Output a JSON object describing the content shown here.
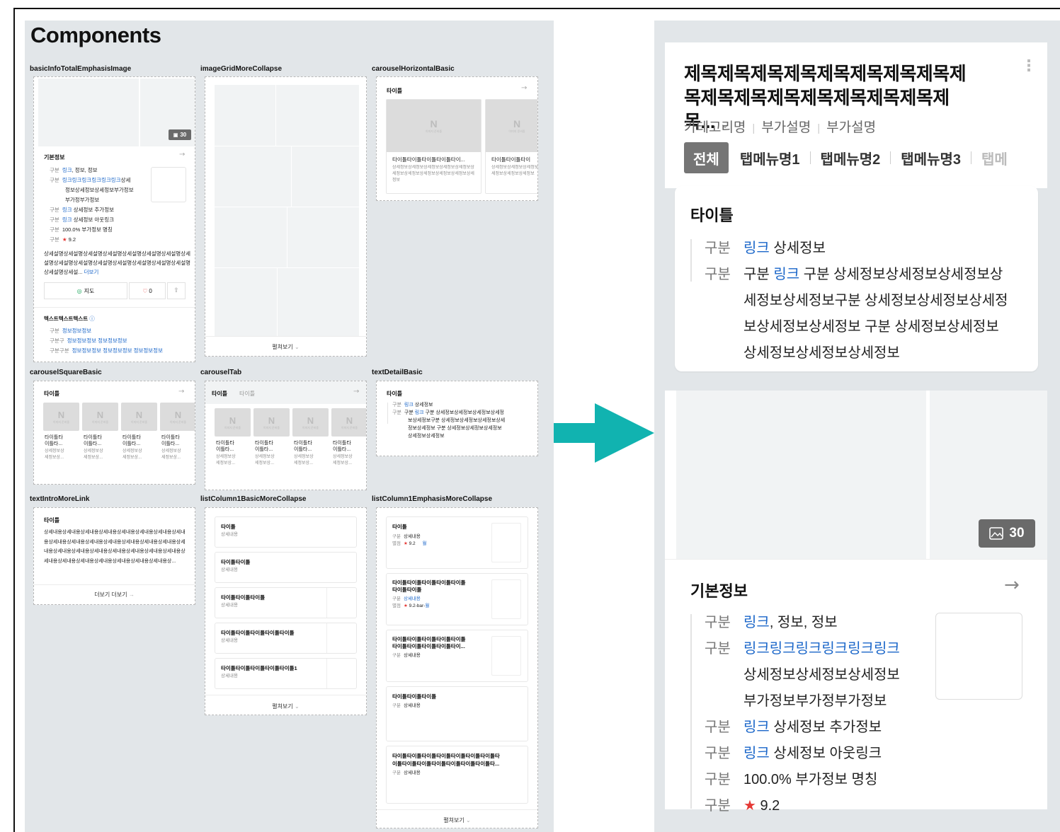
{
  "canvas": {
    "title": "Components"
  },
  "labels": {
    "l1": "basicInfoTotalEmphasisImage",
    "l2": "imageGridMoreCollapse",
    "l3": "carouselHorizontalBasic",
    "l4": "carouselSquareBasic",
    "l5": "carouselTab",
    "l6": "textDetailBasic",
    "l7": "textIntroMoreLink",
    "l8": "listColumn1BasicMoreCollapse",
    "l9": "listColumn1EmphasisMoreCollapse"
  },
  "basicInfo": {
    "badge": "30",
    "title": "기본정보",
    "k": "구분",
    "r1_link": "링크",
    "r1_rest": ", 정보, 정보",
    "r2_link": "링크링크링크링크링크링크",
    "r2_rest": "상세",
    "r2_cont1": "정보상세정보상세정보부가정보",
    "r2_cont2": "부가정부가정보",
    "r3_link": "링크",
    "r3_rest": " 상세정보 추가정보",
    "r4_link": "링크",
    "r4_rest": " 상세정보 아웃링크",
    "r5_rest": "100.0% 부가정보 명칭",
    "r6_star": "★",
    "r6_rest": " 9.2",
    "desc": "상세설명상세설명상세설명상세설명상세설명상세설명상세설명상세설명상세설명상세설명상세설명상세설명상세설명상세설명상세설명상세설명상세설... ",
    "desc_more": "더보기",
    "btn_map": "지도",
    "btn_like": "0",
    "section2": "텍스트텍스트텍스트",
    "s2_k1": "구분",
    "s2_v1": "정보정보정보",
    "s2_k2": "구분구",
    "s2_v2": "정보정보정보 정보정보정보",
    "s2_k3": "구분구분",
    "s2_v3": "정보정보정보 정보정보정보 정보정보정보"
  },
  "imageGrid": {
    "more": "펼쳐보기"
  },
  "carouselH": {
    "title": "타이틀",
    "nbox_caption": "이미지 준비중",
    "c1_title": "타이틀타이틀타이틀타이틀타이...",
    "c1_desc": "상세정보상세정보상세정보상세정보상세정보상세정보상세정보상세정보상세정보상세정보상세정보",
    "c2_title": "타이틀타이틀타이",
    "c2_desc": "상세정보상세정보상세정보상세정보상세정보상세정보"
  },
  "carouselSquare": {
    "title": "타이틀",
    "item_title1": "타이틀타",
    "item_title2": "이틀타...",
    "item_desc1": "상세정보상",
    "item_desc2": "세정보상..."
  },
  "carouselTab": {
    "tab1": "타이틀",
    "tab2": "타이틀"
  },
  "textDetail": {
    "title": "타이틀",
    "k": "구분",
    "r1_link": "링크",
    "r1_rest": " 상세정보",
    "r2_a": "구분 ",
    "r2_link": "링크",
    "r2_b": " 구분 상세정보상세정보상세정보상세정",
    "r2_c2": "보상세정보구분 상세정보상세정보상세정보상세",
    "r2_c3": "정보상세정보 구분 상세정보상세정보상세정보",
    "r2_c4": "상세정보상세정보"
  },
  "textIntro": {
    "title": "타이틀",
    "body": "상세내용상세내용상세내용상세내용상세내용상세내용상세내용상세내용상세내용상세내용상세내용상세내용상세내용상세내용상세내용상세내용상세내용상세내용상세내용상세내용상세내용상세내용상세내용상세내용상세내용상세내용상세내용상세내용상세내용상세내용상...",
    "more": "더보기 더보기"
  },
  "listBasic": {
    "items": [
      {
        "title": "타이틀",
        "desc": "상세내용"
      },
      {
        "title": "타이틀타이틀",
        "desc": "상세내용"
      },
      {
        "title": "타이틀타이틀타이틀",
        "desc": "상세내용"
      },
      {
        "title": "타이틀타이틀타이틀타이틀타이틀",
        "desc": "상세내용"
      },
      {
        "title": "타이틀타이틀타이틀타이틀타이틀1",
        "desc": "상세내용"
      }
    ],
    "more": "펼쳐보기"
  },
  "listEmph": {
    "i1_title": "타이틀",
    "i1_k": "구분",
    "i1_v": "상세내용",
    "i1_k2": "별점",
    "i1_star": "★",
    "i1_score": " 9.2",
    "i1_link": "월",
    "i2_title": "타이틀타이틀타이틀타이틀타이틀",
    "i2_title2": "타이틀타이틀",
    "i2_k": "구분",
    "i2_v": "상세내용",
    "i2_k2": "별점",
    "i2_star": "★",
    "i2_score": " 9.2-bar-",
    "i2_link": "월",
    "i3_title": "타이틀타이틀타이틀타이틀타이틀",
    "i3_title2": "타이틀타이틀타이틀타이틀타이...",
    "i3_k": "구분",
    "i3_v": "상세내용",
    "i4_title": "타이틀타이틀타이틀",
    "i4_k": "구분",
    "i4_v": "상세내용",
    "i5_title": "타이틀타이틀타이틀타이틀타이틀타이틀타이틀타",
    "i5_title2": "이틀타이틀타이틀타이틀타이틀타이틀타이틀타...",
    "i5_k": "구분",
    "i5_v": "상세내용",
    "more": "펼쳐보기"
  },
  "detail": {
    "title_line1": "제목제목제목제목제목제목제목제목제",
    "title_line2": "목제목제목제목제목제목제목제목제목...",
    "sub1": "카테고리명",
    "sub2": "부가설명",
    "sub3": "부가설명",
    "tabs": [
      "전체",
      "탭메뉴명1",
      "탭메뉴명2",
      "탭메뉴명3",
      "탭메"
    ],
    "card_title": "타이틀",
    "k": "구분",
    "c_r1_link": "링크",
    "c_r1_rest": " 상세정보",
    "c_r2_a": "구분 ",
    "c_r2_link": "링크",
    "c_r2_b": " 구분 상세정보상세정보상세정보상",
    "c_r2_c2": "세정보상세정보구분 상세정보상세정보상세정",
    "c_r2_c3": "보상세정보상세정보 구분 상세정보상세정보",
    "c_r2_c4": "상세정보상세정보상세정보",
    "badge": "30",
    "info_title": "기본정보",
    "i_r1_link": "링크",
    "i_r1_rest": ", 정보, 정보",
    "i_r2_link": "링크링크링크링크링크링크",
    "i_r2_c1": "상세정보상세정보상세정보",
    "i_r2_c2": "부가정보부가정부가정보",
    "i_r3_link": "링크",
    "i_r3_rest": " 상세정보 추가정보",
    "i_r4_link": "링크",
    "i_r4_rest": " 상세정보 아웃링크",
    "i_r5_rest": "100.0% 부가정보 명칭",
    "i_r6_star": "★",
    "i_r6_rest": " 9.2"
  },
  "colors": {
    "accent": "#1a66c9",
    "star": "#e53935",
    "arrow": "#11b3b0",
    "panel": "#e2e6e9"
  },
  "icons": {
    "map": "pin-icon",
    "like": "heart-icon",
    "share": "share-icon",
    "more": "kebab-icon",
    "gallery": "image-icon"
  }
}
